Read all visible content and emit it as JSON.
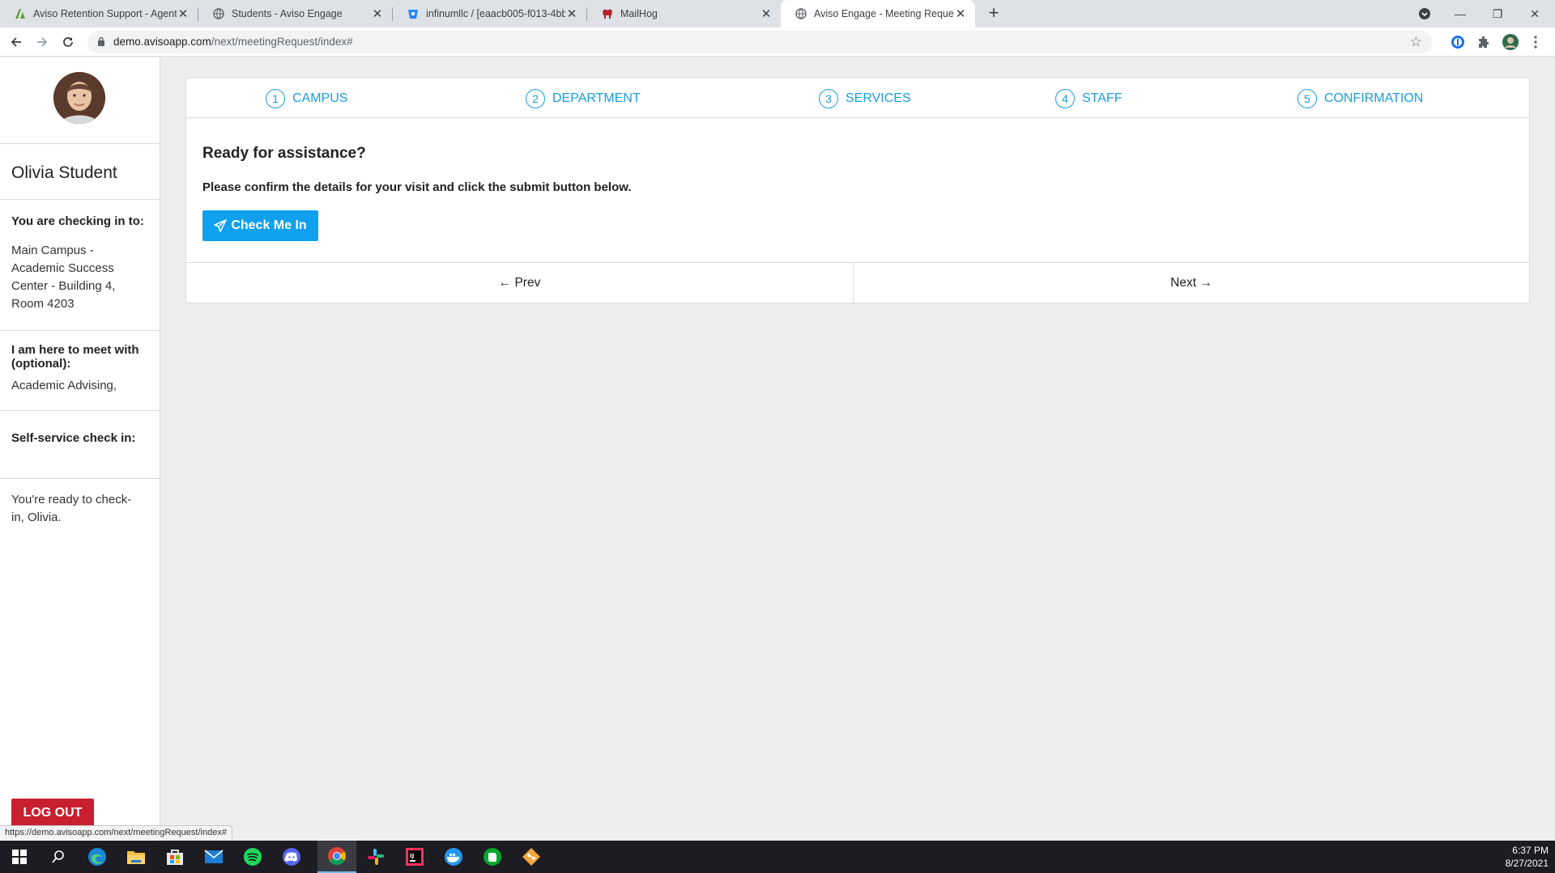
{
  "browser": {
    "tabs": [
      {
        "title": "Aviso Retention Support - Agent",
        "icon": "aviso-agent-icon"
      },
      {
        "title": "Students - Aviso Engage",
        "icon": "globe-icon"
      },
      {
        "title": "infinumllc / [eaacb005-f013-4bb",
        "icon": "bitbucket-icon"
      },
      {
        "title": "MailHog",
        "icon": "mailhog-icon"
      },
      {
        "title": "Aviso Engage - Meeting Request",
        "icon": "globe-icon",
        "active": true
      }
    ],
    "url_host": "demo.avisoapp.com",
    "url_path": "/next/meetingRequest/index#",
    "status_link": "https://demo.avisoapp.com/next/meetingRequest/index#"
  },
  "sidebar": {
    "user_name": "Olivia Student",
    "checking_in_heading": "You are checking in to:",
    "location": "Main Campus - Academic Success Center - Building 4, Room 4203",
    "meet_with_heading": "I am here to meet with (optional):",
    "meet_with_value": "Academic Advising,",
    "self_service_heading": "Self-service check in:",
    "ready_message": "You're ready to check-in, Olivia.",
    "logout_label": "LOG OUT"
  },
  "wizard": {
    "steps": [
      {
        "number": "1",
        "label": "CAMPUS"
      },
      {
        "number": "2",
        "label": "DEPARTMENT"
      },
      {
        "number": "3",
        "label": "SERVICES"
      },
      {
        "number": "4",
        "label": "STAFF"
      },
      {
        "number": "5",
        "label": "CONFIRMATION"
      }
    ],
    "heading": "Ready for assistance?",
    "instructions": "Please confirm the details for your visit and click the submit button below.",
    "checkin_label": "Check Me In",
    "prev_label": "← Prev",
    "next_label": "Next →"
  },
  "taskbar": {
    "apps": [
      "windows-start-icon",
      "search-icon",
      "edge-icon",
      "file-explorer-icon",
      "store-icon",
      "mail-icon",
      "spotify-icon",
      "discord-icon",
      "chrome-icon",
      "slack-icon",
      "intellij-icon",
      "docker-icon",
      "evernote-icon",
      "git-icon"
    ],
    "time": "6:37 PM",
    "date": "8/27/2021"
  },
  "colors": {
    "accent": "#1a9de0",
    "button": "#0fa0ee",
    "logout": "#c8202f"
  }
}
